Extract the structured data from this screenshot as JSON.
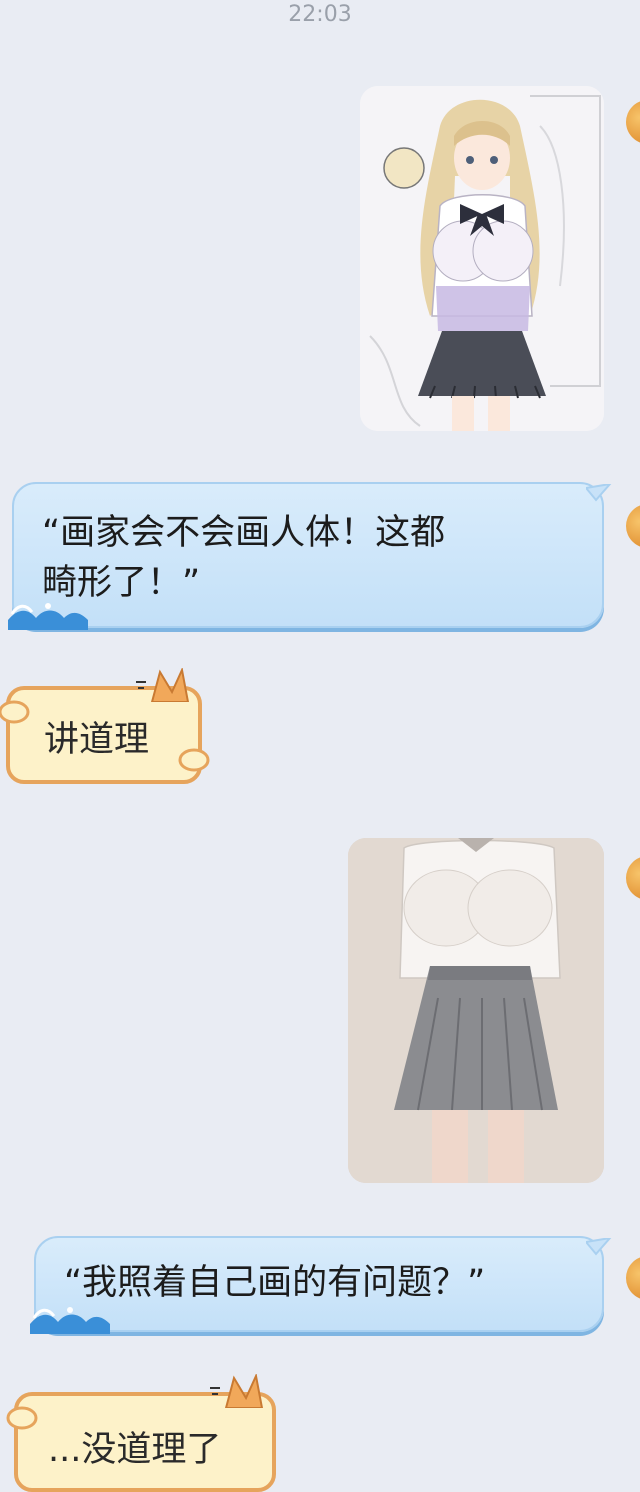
{
  "status": {
    "time": "22:03"
  },
  "messages": [
    {
      "side": "right",
      "type": "image",
      "image_kind": "anime-girl-illustration"
    },
    {
      "side": "right",
      "type": "text",
      "text": "“画家会不会画人体！这都",
      "text_line2": "畸形了！”"
    },
    {
      "side": "left",
      "type": "text",
      "text": "讲道理"
    },
    {
      "side": "right",
      "type": "image",
      "image_kind": "real-photo-school-uniform"
    },
    {
      "side": "right",
      "type": "text",
      "text": "“我照着自己画的有问题？”"
    },
    {
      "side": "left",
      "type": "text",
      "text": "...没道理了"
    }
  ],
  "colors": {
    "background": "#e9ecf3",
    "blue_bubble": "#c3e0f8",
    "cat_bubble": "#fdf2c9",
    "cat_border": "#e6a45c",
    "avatar": "#e4973a"
  }
}
